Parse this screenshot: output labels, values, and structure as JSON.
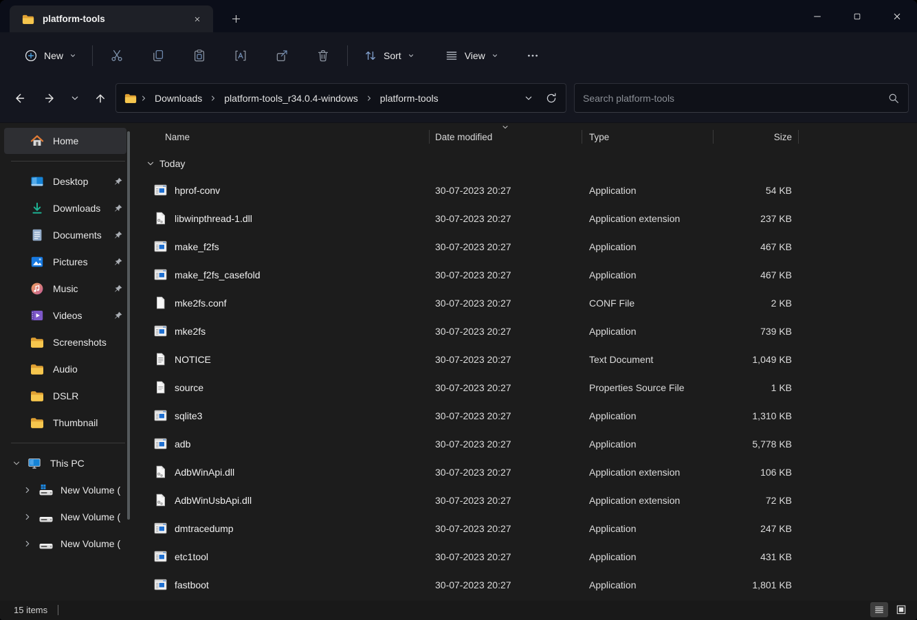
{
  "tab_bar": {
    "active_tab": {
      "label": "platform-tools"
    }
  },
  "window_controls": {
    "minimize": "minimize",
    "maximize": "maximize",
    "close": "close"
  },
  "toolbar": {
    "new_label": "New",
    "sort_label": "Sort",
    "view_label": "View",
    "icon_buttons": [
      "cut",
      "copy",
      "paste",
      "rename",
      "share",
      "delete",
      "more"
    ]
  },
  "nav": {
    "breadcrumbs": [
      "Downloads",
      "platform-tools_r34.0.4-windows",
      "platform-tools"
    ]
  },
  "search": {
    "placeholder": "Search platform-tools"
  },
  "sidebar": {
    "home": {
      "label": "Home"
    },
    "quick_access": [
      {
        "label": "Desktop",
        "icon": "desktop-icon",
        "pinned": true
      },
      {
        "label": "Downloads",
        "icon": "downloads-icon",
        "pinned": true
      },
      {
        "label": "Documents",
        "icon": "documents-icon",
        "pinned": true
      },
      {
        "label": "Pictures",
        "icon": "pictures-icon",
        "pinned": true
      },
      {
        "label": "Music",
        "icon": "music-icon",
        "pinned": true
      },
      {
        "label": "Videos",
        "icon": "videos-icon",
        "pinned": true
      },
      {
        "label": "Screenshots",
        "icon": "folder-icon",
        "pinned": false
      },
      {
        "label": "Audio",
        "icon": "folder-icon",
        "pinned": false
      },
      {
        "label": "DSLR",
        "icon": "folder-icon",
        "pinned": false
      },
      {
        "label": "Thumbnail",
        "icon": "folder-icon",
        "pinned": false
      }
    ],
    "this_pc": {
      "label": "This PC"
    },
    "drives": [
      {
        "label": "New Volume (",
        "os_drive": true
      },
      {
        "label": "New Volume (",
        "os_drive": false
      },
      {
        "label": "New Volume (",
        "os_drive": false
      }
    ]
  },
  "file_list": {
    "columns": [
      "Name",
      "Date modified",
      "Type",
      "Size"
    ],
    "sorted_by": "Date modified",
    "group_label": "Today",
    "rows": [
      {
        "name": "hprof-conv",
        "icon": "app-icon",
        "date": "30-07-2023 20:27",
        "type": "Application",
        "size": "54 KB"
      },
      {
        "name": "libwinpthread-1.dll",
        "icon": "dll-icon",
        "date": "30-07-2023 20:27",
        "type": "Application extension",
        "size": "237 KB"
      },
      {
        "name": "make_f2fs",
        "icon": "app-icon",
        "date": "30-07-2023 20:27",
        "type": "Application",
        "size": "467 KB"
      },
      {
        "name": "make_f2fs_casefold",
        "icon": "app-icon",
        "date": "30-07-2023 20:27",
        "type": "Application",
        "size": "467 KB"
      },
      {
        "name": "mke2fs.conf",
        "icon": "file-icon",
        "date": "30-07-2023 20:27",
        "type": "CONF File",
        "size": "2 KB"
      },
      {
        "name": "mke2fs",
        "icon": "app-icon",
        "date": "30-07-2023 20:27",
        "type": "Application",
        "size": "739 KB"
      },
      {
        "name": "NOTICE",
        "icon": "textdoc-icon",
        "date": "30-07-2023 20:27",
        "type": "Text Document",
        "size": "1,049 KB"
      },
      {
        "name": "source",
        "icon": "sourcedoc-icon",
        "date": "30-07-2023 20:27",
        "type": "Properties Source File",
        "size": "1 KB"
      },
      {
        "name": "sqlite3",
        "icon": "app-icon",
        "date": "30-07-2023 20:27",
        "type": "Application",
        "size": "1,310 KB"
      },
      {
        "name": "adb",
        "icon": "app-icon",
        "date": "30-07-2023 20:27",
        "type": "Application",
        "size": "5,778 KB"
      },
      {
        "name": "AdbWinApi.dll",
        "icon": "dll-icon",
        "date": "30-07-2023 20:27",
        "type": "Application extension",
        "size": "106 KB"
      },
      {
        "name": "AdbWinUsbApi.dll",
        "icon": "dll-icon",
        "date": "30-07-2023 20:27",
        "type": "Application extension",
        "size": "72 KB"
      },
      {
        "name": "dmtracedump",
        "icon": "app-icon",
        "date": "30-07-2023 20:27",
        "type": "Application",
        "size": "247 KB"
      },
      {
        "name": "etc1tool",
        "icon": "app-icon",
        "date": "30-07-2023 20:27",
        "type": "Application",
        "size": "431 KB"
      },
      {
        "name": "fastboot",
        "icon": "app-icon",
        "date": "30-07-2023 20:27",
        "type": "Application",
        "size": "1,801 KB"
      }
    ]
  },
  "status_bar": {
    "items_count": "15 items"
  }
}
